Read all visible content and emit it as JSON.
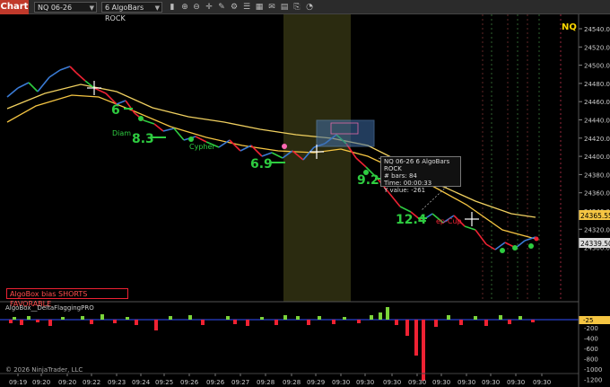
{
  "toolbar": {
    "chart_tab": "Chart",
    "instrument": "NQ 06-26",
    "bar_type": "6 AlgoBars ROCK",
    "icons": [
      "bars-icon",
      "zoom-in-icon",
      "zoom-out-icon",
      "crosshair-icon",
      "drawing-icon",
      "strategy-icon",
      "properties-icon",
      "layout-icon",
      "alerts-icon",
      "data-icon",
      "attach-icon",
      "settings-icon"
    ]
  },
  "chart": {
    "symbol_label": "NQ",
    "price_ticks": [
      "24540.00",
      "24520.00",
      "24500.00",
      "24480.00",
      "24460.00",
      "24440.00",
      "24420.00",
      "24400.00",
      "24380.00",
      "24360.00",
      "24340.00",
      "24320.00",
      "24300.00"
    ],
    "current_price": "24365.55",
    "last_price": "24339.50",
    "bias_label": "AlgoBox bias SHORTS FAVORABLE",
    "signals": [
      {
        "label": "6",
        "color": "#2ecc40"
      },
      {
        "label": "Diam",
        "color": "#2ecc40"
      },
      {
        "label": "8.3",
        "color": "#2ecc40"
      },
      {
        "label": "Cypher",
        "color": "#2ecc40"
      },
      {
        "label": "6.9",
        "color": "#2ecc40"
      },
      {
        "label": "9.2",
        "color": "#2ecc40"
      },
      {
        "label": "12.4",
        "color": "#2ecc40"
      },
      {
        "label": "ep-Cup",
        "color": "#e23"
      }
    ],
    "tooltip": {
      "title": "NQ 06-26 6 AlgoBars ROCK",
      "bars_label": "# bars:",
      "bars_value": "84",
      "time_label": "Time:",
      "time_value": "00:00:33",
      "yvalue_label": "Y value:",
      "yvalue_value": "-261"
    }
  },
  "indicator": {
    "name": "AlgoBox__DeltaFlaggingPRO",
    "ticks": [
      "-200",
      "-400",
      "-600",
      "-800",
      "-1000",
      "-1200"
    ],
    "current_value": "-25"
  },
  "time_axis": [
    "09:19",
    "09:20",
    "09:20",
    "09:22",
    "09:23",
    "09:24",
    "09:25",
    "09:26",
    "09:26",
    "09:27",
    "09:28",
    "09:28",
    "09:29",
    "09:30",
    "09:30",
    "09:30",
    "09:30",
    "09:30",
    "09:30",
    "09:30",
    "09:30",
    "09:30"
  ],
  "copyright": "© 2026 NinjaTrader, LLC"
}
